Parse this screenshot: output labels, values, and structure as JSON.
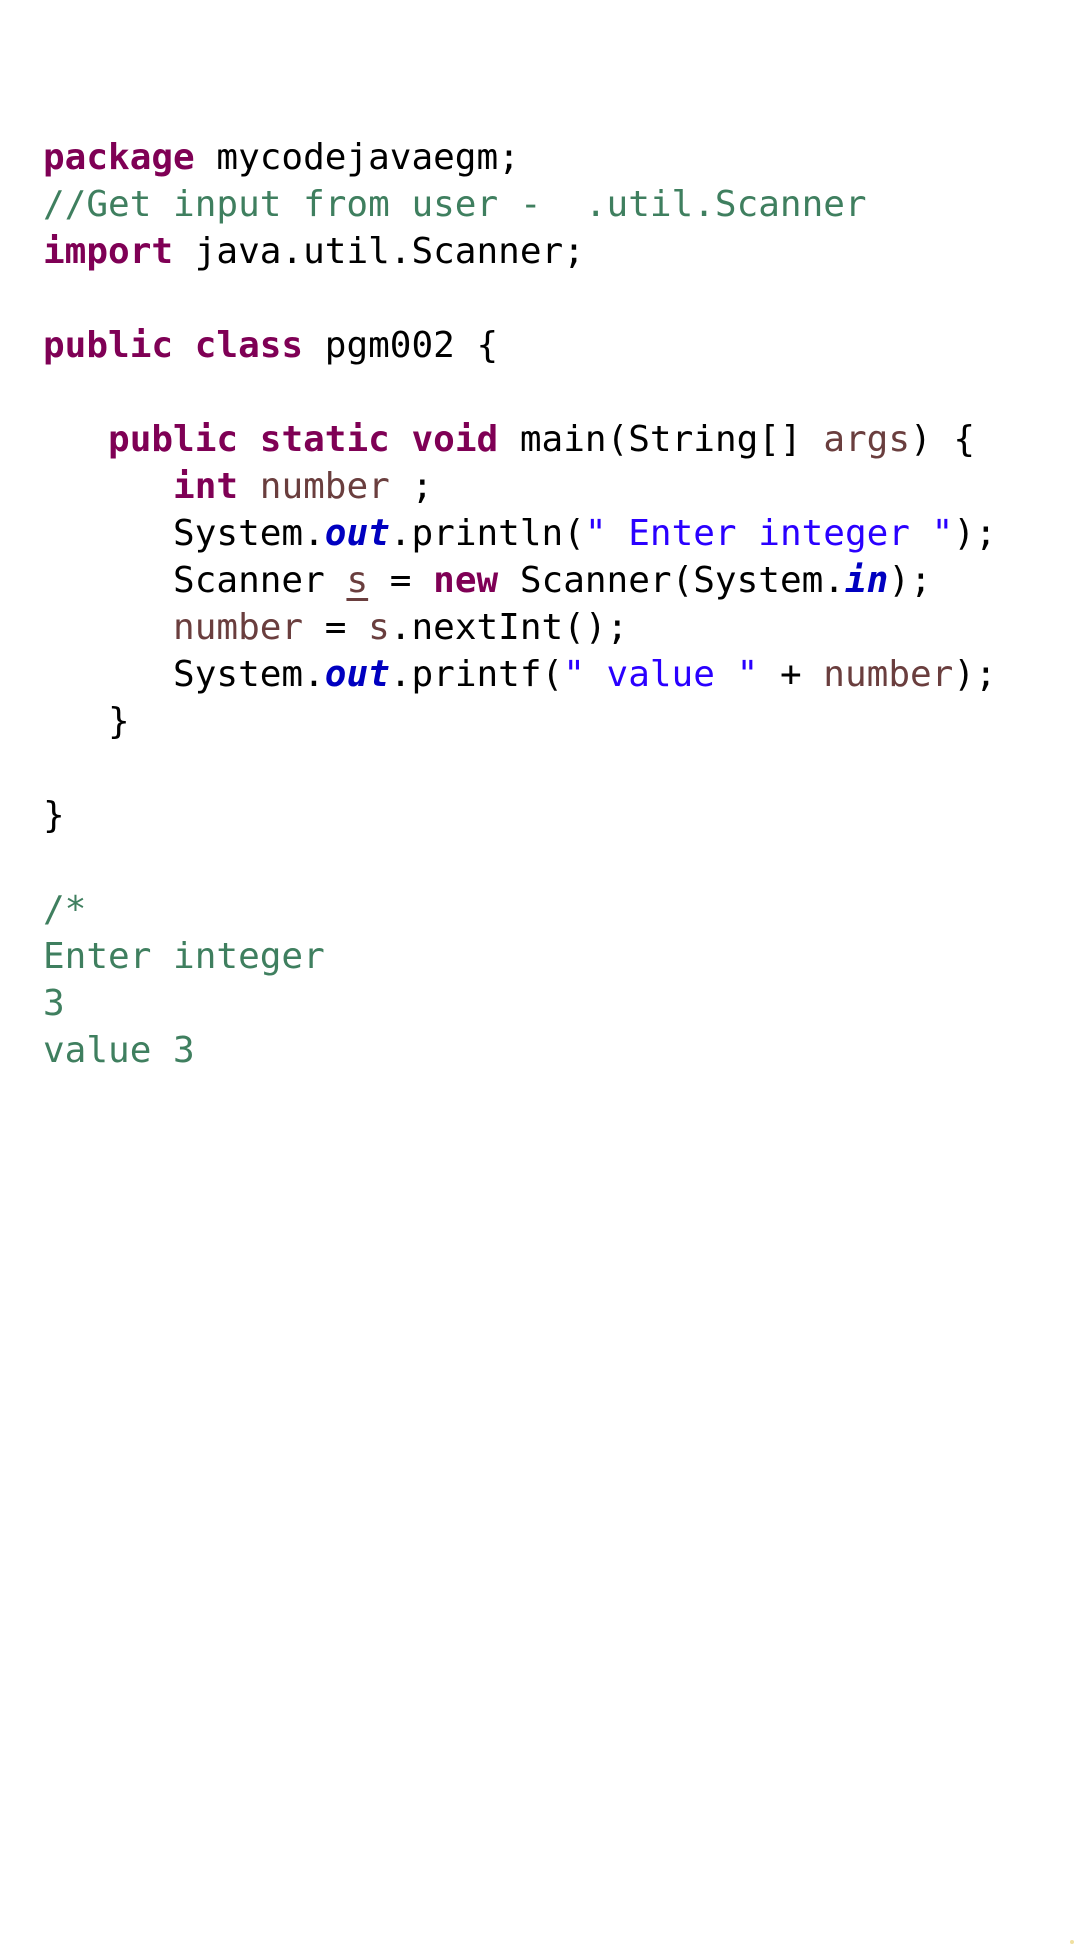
{
  "colors": {
    "keyword": "#7f0055",
    "comment": "#3f7f5f",
    "string": "#2a00ff",
    "local_variable": "#6a3e3e",
    "static_field": "#0000c0",
    "plain": "#000000",
    "background": "#ffffff"
  },
  "code": {
    "lines": [
      [
        {
          "t": "package",
          "c": "kw"
        },
        {
          "t": " mycodejavaegm;",
          "c": ""
        }
      ],
      [
        {
          "t": "//Get input from user -  .util.Scanner",
          "c": "cm"
        }
      ],
      [
        {
          "t": "import",
          "c": "kw"
        },
        {
          "t": " java.util.Scanner;",
          "c": ""
        }
      ],
      [],
      [
        {
          "t": "public",
          "c": "kw"
        },
        {
          "t": " ",
          "c": ""
        },
        {
          "t": "class",
          "c": "kw"
        },
        {
          "t": " pgm002 {",
          "c": ""
        }
      ],
      [],
      [
        {
          "t": "   ",
          "c": ""
        },
        {
          "t": "public",
          "c": "kw"
        },
        {
          "t": " ",
          "c": ""
        },
        {
          "t": "static",
          "c": "kw"
        },
        {
          "t": " ",
          "c": ""
        },
        {
          "t": "void",
          "c": "kw"
        },
        {
          "t": " main(String[] ",
          "c": ""
        },
        {
          "t": "args",
          "c": "var"
        },
        {
          "t": ") {",
          "c": ""
        }
      ],
      [
        {
          "t": "      ",
          "c": ""
        },
        {
          "t": "int",
          "c": "kw"
        },
        {
          "t": " ",
          "c": ""
        },
        {
          "t": "number",
          "c": "var"
        },
        {
          "t": " ;",
          "c": ""
        }
      ],
      [
        {
          "t": "      System.",
          "c": ""
        },
        {
          "t": "out",
          "c": "fld"
        },
        {
          "t": ".println(",
          "c": ""
        },
        {
          "t": "\" Enter integer \"",
          "c": "st"
        },
        {
          "t": ");",
          "c": ""
        }
      ],
      [
        {
          "t": "      Scanner ",
          "c": ""
        },
        {
          "t": "s",
          "c": "var under"
        },
        {
          "t": " = ",
          "c": ""
        },
        {
          "t": "new",
          "c": "kw"
        },
        {
          "t": " Scanner(System.",
          "c": ""
        },
        {
          "t": "in",
          "c": "fld"
        },
        {
          "t": ");",
          "c": ""
        }
      ],
      [
        {
          "t": "      ",
          "c": ""
        },
        {
          "t": "number",
          "c": "var"
        },
        {
          "t": " = ",
          "c": ""
        },
        {
          "t": "s",
          "c": "var"
        },
        {
          "t": ".nextInt();",
          "c": ""
        }
      ],
      [
        {
          "t": "      System.",
          "c": ""
        },
        {
          "t": "out",
          "c": "fld"
        },
        {
          "t": ".printf(",
          "c": ""
        },
        {
          "t": "\" value \"",
          "c": "st"
        },
        {
          "t": " + ",
          "c": ""
        },
        {
          "t": "number",
          "c": "var"
        },
        {
          "t": ");",
          "c": ""
        }
      ],
      [
        {
          "t": "   }",
          "c": ""
        }
      ],
      [],
      [
        {
          "t": "}",
          "c": ""
        }
      ],
      [],
      [
        {
          "t": "/*",
          "c": "cm"
        }
      ],
      [
        {
          "t": "Enter integer",
          "c": "cm"
        }
      ],
      [
        {
          "t": "3",
          "c": "cm"
        }
      ],
      [
        {
          "t": "value 3",
          "c": "cm"
        }
      ]
    ]
  }
}
